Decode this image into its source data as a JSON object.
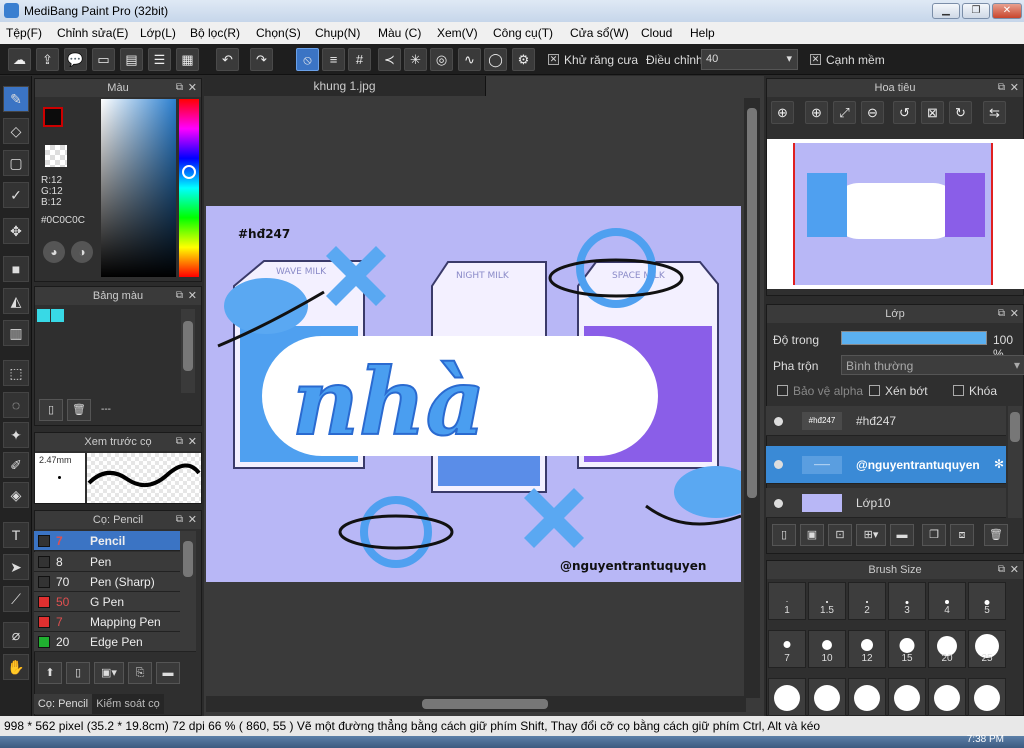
{
  "window": {
    "title": "MediBang Paint Pro (32bit)",
    "minimize": "▁",
    "restore": "❐",
    "close": "✕"
  },
  "menu": [
    "Tệp(F)",
    "Chỉnh sửa(E)",
    "Lớp(L)",
    "Bộ lọc(R)",
    "Chọn(S)",
    "Chụp(N)",
    "Màu (C)",
    "Xem(V)",
    "Công cụ(T)",
    "Cửa sổ(W)",
    "Cloud",
    "Help"
  ],
  "toolbar": {
    "antialias_label": "Khử răng cưa",
    "antialias_checked": "✕",
    "adjust_label": "Điều chỉnh",
    "adjust_value": "40",
    "smooth_label": "Cạnh mềm",
    "smooth_checked": "✕"
  },
  "canvas": {
    "tab": "khung 1.jpg",
    "art_hashtag": "#hđ247",
    "art_credit": "@nguyentrantuquyen",
    "art_title": "nhà",
    "carton1": "WAVE MILK",
    "carton2": "NIGHT MILK",
    "carton3": "SPACE MILK"
  },
  "color_panel": {
    "title": "Màu",
    "r": "R:12",
    "g": "G:12",
    "b": "B:12",
    "hex": "#0C0C0C"
  },
  "palette_panel": {
    "title": "Bảng màu",
    "swatches": [
      "#38d9e6",
      "#38d9e6"
    ],
    "dashes": "---"
  },
  "brush_preview": {
    "title": "Xem trước cọ",
    "size": "2.47mm"
  },
  "brush_panel": {
    "title": "Cọ: Pencil",
    "tab_active": "Cọ: Pencil",
    "tab_other": "Kiểm soát cọ",
    "brushes": [
      {
        "size": "7",
        "name": "Pencil",
        "color": "#333333"
      },
      {
        "size": "8",
        "name": "Pen",
        "color": "#333333"
      },
      {
        "size": "70",
        "name": "Pen (Sharp)",
        "color": "#333333"
      },
      {
        "size": "50",
        "name": "G Pen",
        "color": "#e03030"
      },
      {
        "size": "7",
        "name": "Mapping Pen",
        "color": "#e03030"
      },
      {
        "size": "20",
        "name": "Edge Pen",
        "color": "#20b030"
      }
    ]
  },
  "navigator": {
    "title": "Hoa tiêu"
  },
  "layers": {
    "title": "Lớp",
    "opacity_label": "Độ trong",
    "opacity_value": "100 %",
    "blend_label": "Pha trộn",
    "blend_value": "Bình thường",
    "protect_alpha": "Bảo vệ alpha",
    "clipping": "Xén bớt",
    "lock": "Khóa",
    "items": [
      {
        "name": "#hđ247",
        "thumb": "#hđ247"
      },
      {
        "name": "@nguyentrantuquyen",
        "thumb": "——"
      },
      {
        "name": "Lớp10",
        "thumb": ""
      }
    ]
  },
  "brush_size": {
    "title": "Brush Size",
    "sizes": [
      "1",
      "1.5",
      "2",
      "3",
      "4",
      "5",
      "7",
      "10",
      "12",
      "15",
      "20",
      "25"
    ]
  },
  "status": "998 * 562 pixel   (35.2 * 19.8cm)   72 dpi   66 %   ( 860, 55 )   Vẽ một đường thẳng bằng cách giữ phím Shift, Thay đổi cỡ cọ bằng cách giữ phím Ctrl, Alt và kéo",
  "clock": "7:38 PM"
}
